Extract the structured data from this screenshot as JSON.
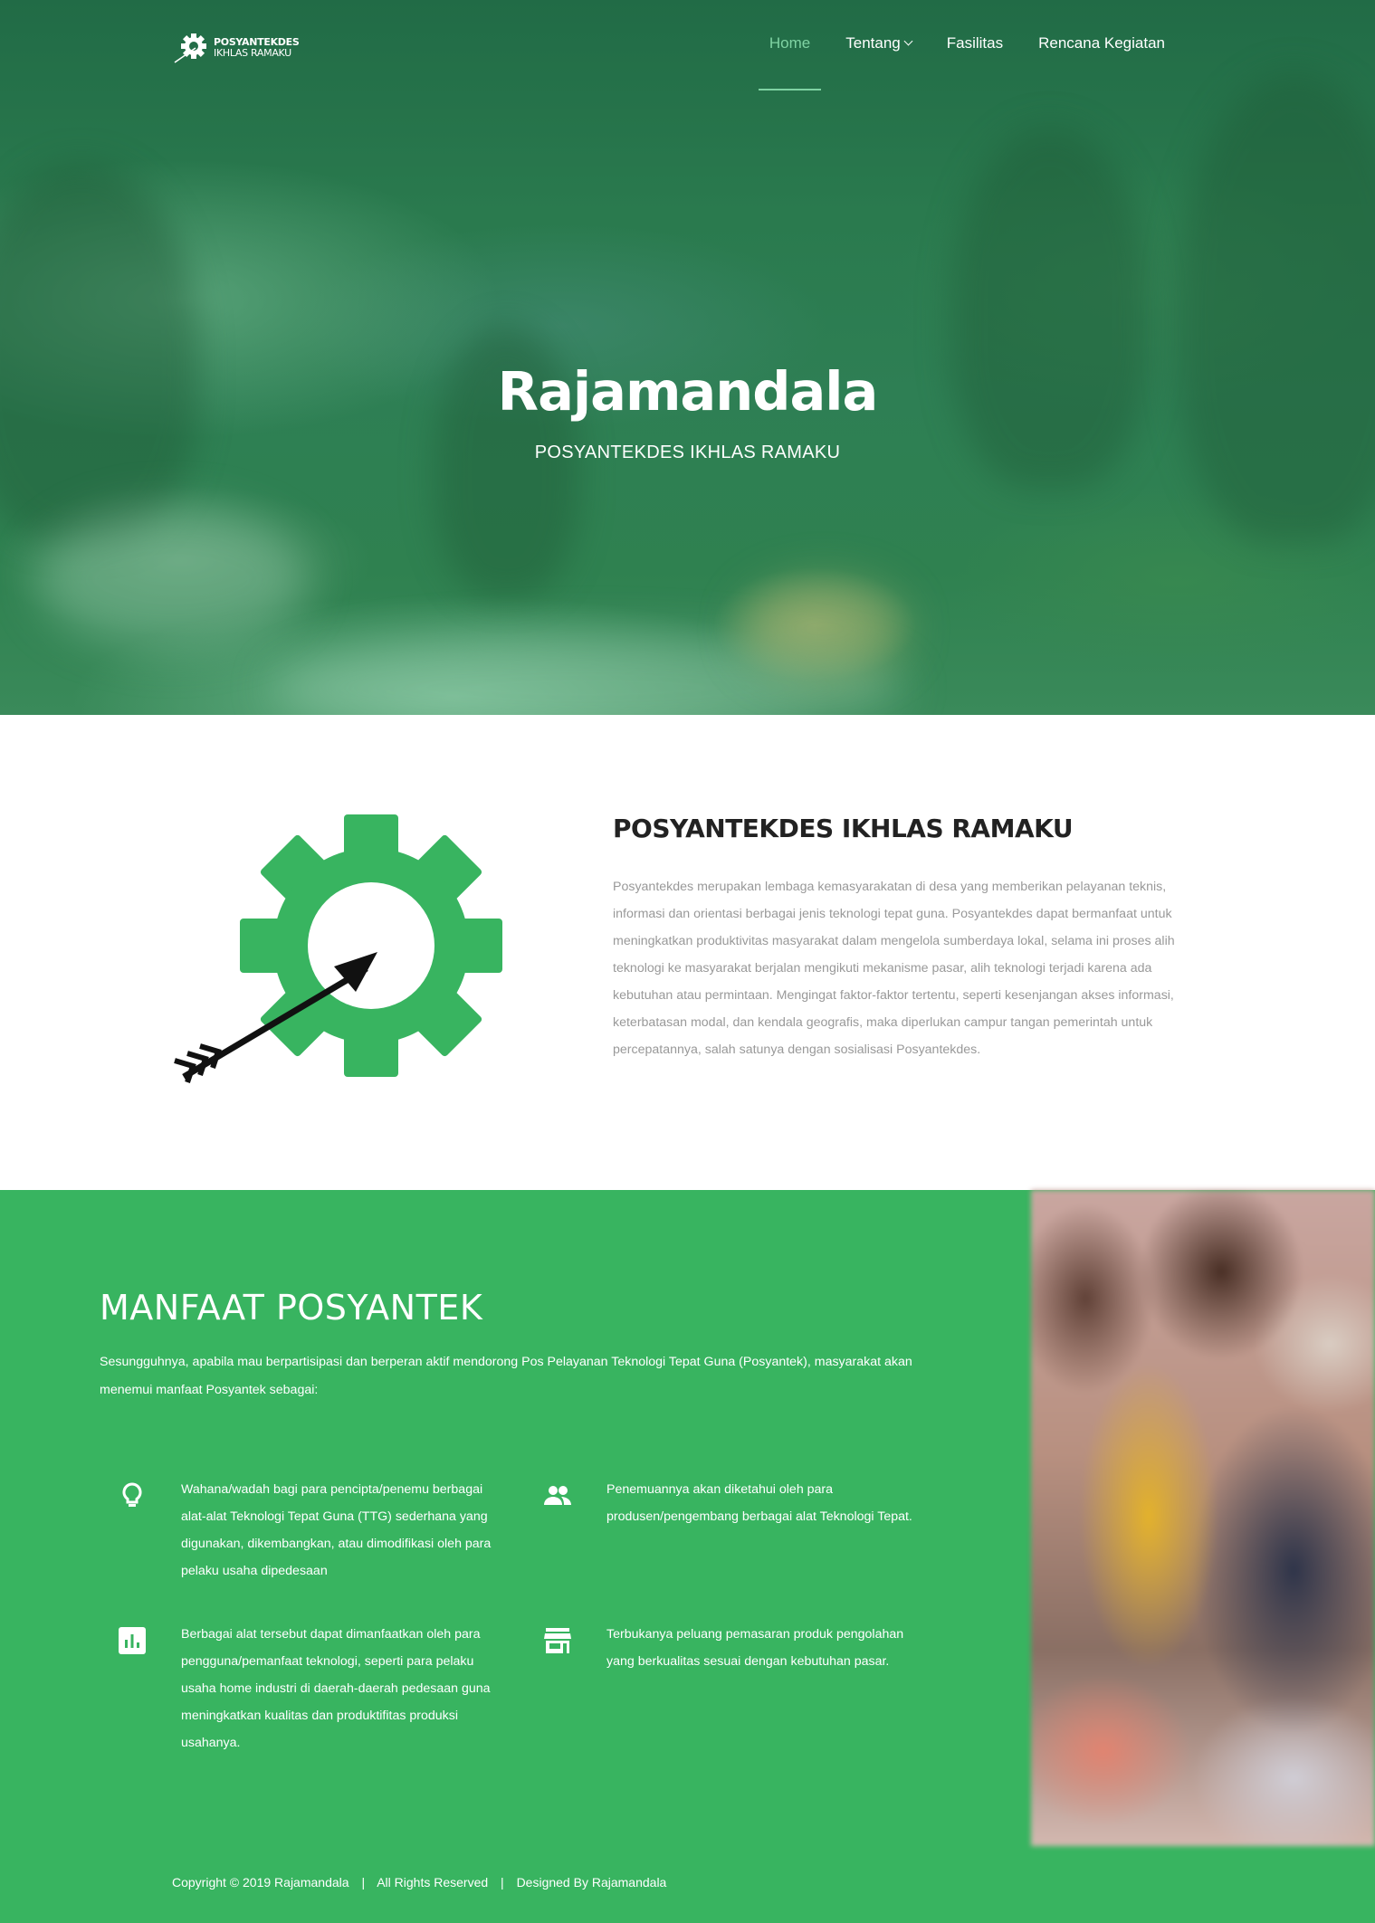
{
  "nav": {
    "logo_line1": "POSYANTEKDES",
    "logo_line2": "IKHLAS RAMAKU",
    "items": [
      {
        "label": "Home"
      },
      {
        "label": "Tentang"
      },
      {
        "label": "Fasilitas"
      },
      {
        "label": "Rencana Kegiatan"
      }
    ]
  },
  "hero": {
    "title": "Rajamandala",
    "subtitle": "POSYANTEKDES IKHLAS RAMAKU"
  },
  "about": {
    "title": "POSYANTEKDES IKHLAS RAMAKU",
    "text": "Posyantekdes merupakan lembaga kemasyarakatan di desa yang memberikan pelayanan teknis, informasi dan orientasi berbagai jenis teknologi tepat guna. Posyantekdes dapat bermanfaat untuk meningkatkan produktivitas masyarakat dalam mengelola sumberdaya lokal, selama ini proses alih teknologi ke masyarakat berjalan mengikuti mekanisme pasar, alih teknologi terjadi karena ada kebutuhan atau permintaan. Mengingat faktor-faktor tertentu, seperti kesenjangan akses informasi, keterbatasan modal, dan kendala geografis, maka diperlukan campur tangan pemerintah untuk percepatannya, salah satunya dengan sosialisasi Posyantekdes."
  },
  "manfaat": {
    "title": "MANFAAT POSYANTEK",
    "intro": "Sesungguhnya, apabila mau berpartisipasi dan berperan aktif mendorong Pos Pelayanan Teknologi Tepat Guna (Posyantek), masyarakat akan menemui manfaat Posyantek sebagai:",
    "features": [
      {
        "icon": "lightbulb-icon",
        "text": "Wahana/wadah bagi para pencipta/penemu berbagai alat-alat Teknologi Tepat Guna (TTG) sederhana yang digunakan, dikembangkan, atau dimodifikasi oleh para pelaku usaha dipedesaan"
      },
      {
        "icon": "people-icon",
        "text": "Penemuannya akan diketahui oleh para produsen/pengembang berbagai alat Teknologi Tepat."
      },
      {
        "icon": "bar-chart-icon",
        "text": "Berbagai alat tersebut dapat dimanfaatkan oleh para pengguna/pemanfaat teknologi, seperti para pelaku usaha home industri di daerah-daerah pedesaan guna meningkatkan kualitas dan produktifitas produksi usahanya."
      },
      {
        "icon": "store-icon",
        "text": "Terbukanya peluang pemasaran produk pengolahan yang berkualitas sesuai dengan kebutuhan pasar."
      }
    ]
  },
  "footer": {
    "copyright": "Copyright © 2019",
    "brand1": "Rajamandala",
    "rights": "All Rights Reserved",
    "designed_by": "Designed By",
    "brand2": "Rajamandala"
  },
  "colors": {
    "primary_green": "#38b460",
    "hero_green": "#2a7a4e",
    "nav_active": "#7fd3a3",
    "heading_dark": "#222222",
    "body_gray": "#999999"
  }
}
